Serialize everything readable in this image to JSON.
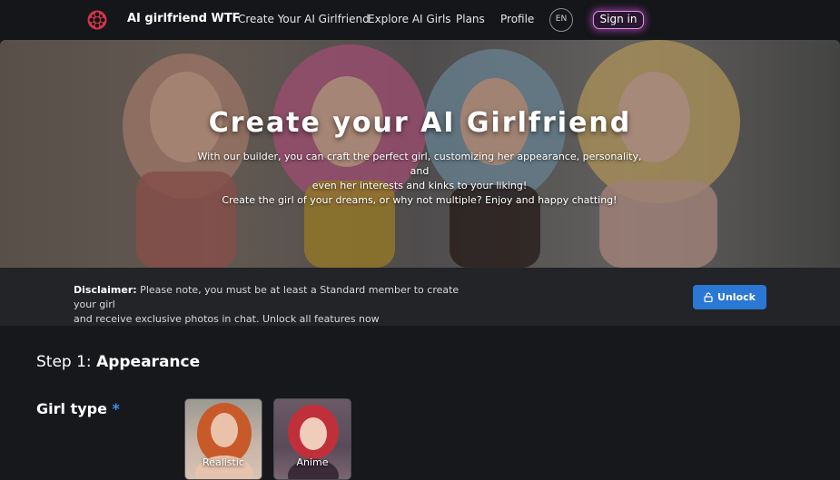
{
  "nav": {
    "brand": "AI girlfriend WTF",
    "links": [
      "Create Your AI Girlfriend",
      "Explore AI Girls",
      "Plans",
      "Profile"
    ],
    "lang": "EN",
    "signin": "Sign in"
  },
  "hero": {
    "title": "Create your AI Girlfriend",
    "desc_lines": [
      "With our builder, you can craft the perfect girl, customizing her appearance, personality, and",
      "even her interests and kinks to your liking!",
      "Create the girl of your dreams, or why not multiple? Enjoy and happy chatting!"
    ]
  },
  "disclaimer": {
    "label": "Disclaimer:",
    "text_line1": " Please note, you must be at least a Standard member to create your girl",
    "text_line2": "and receive exclusive photos in chat. Unlock all features now",
    "button": "Unlock"
  },
  "step": {
    "prefix": "Step 1: ",
    "name": "Appearance"
  },
  "girl_type": {
    "label": "Girl type",
    "required_mark": "*",
    "options": [
      "Realistic",
      "Anime"
    ]
  },
  "colors": {
    "accent": "#2b77d4",
    "signin_glow": "#e68cf0",
    "logo": "#d8344a"
  }
}
